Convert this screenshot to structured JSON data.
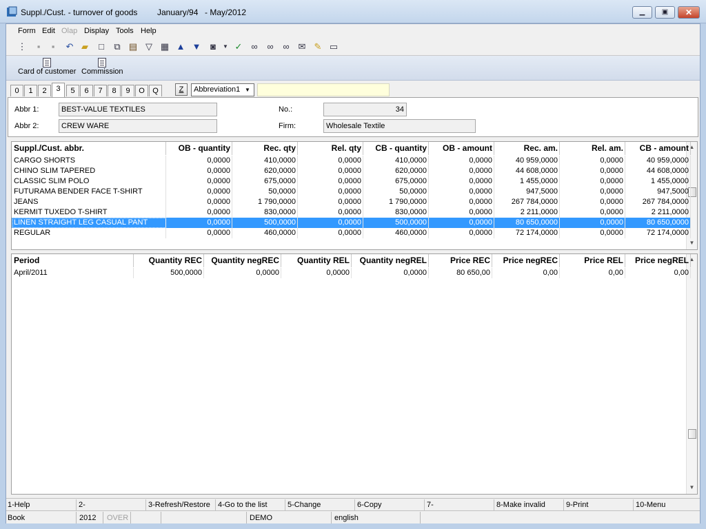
{
  "window": {
    "title": "Suppl./Cust. - turnover of goods",
    "period_from": "January/94",
    "period_to": "- May/2012",
    "min_label": "▁",
    "max_label": "▣",
    "close_label": "✕"
  },
  "menu": [
    "Form",
    "Edit",
    "Olap",
    "Display",
    "Tools",
    "Help"
  ],
  "toolbar_icons": [
    "tree-icon",
    "save-icon",
    "save-all-icon",
    "undo-icon",
    "open-folder-icon",
    "new-document-icon",
    "copy-icon",
    "book-icon",
    "filter-icon",
    "filter-list-icon",
    "arrow-up-icon",
    "arrow-down-icon",
    "camera-icon",
    "dropdown-arrow-icon",
    "check-recycle-icon",
    "binoculars-icon",
    "binoculars-find-icon",
    "binoculars-next-icon",
    "mail-icon",
    "edit-note-icon",
    "report-icon"
  ],
  "commands": {
    "card_of_customer": "Card of customer",
    "commission": "Commission"
  },
  "tabs": [
    "0",
    "1",
    "2",
    "3",
    "5",
    "6",
    "7",
    "8",
    "9",
    "O",
    "Q"
  ],
  "active_tab": "3",
  "z_button": "Z",
  "sort_combo": "Abbreviation1",
  "header": {
    "abbr1_label": "Abbr 1:",
    "abbr1_value": "BEST-VALUE TEXTILES",
    "abbr2_label": "Abbr 2:",
    "abbr2_value": "CREW WARE",
    "no_label": "No.:",
    "no_value": "34",
    "firm_label": "Firm:",
    "firm_value": "Wholesale Textile"
  },
  "top_grid": {
    "columns": [
      "Suppl./Cust. abbr.",
      "OB - quantity",
      "Rec. qty",
      "Rel. qty",
      "CB - quantity",
      "OB - amount",
      "Rec. am.",
      "Rel. am.",
      "CB - amount"
    ],
    "rows": [
      [
        "CARGO SHORTS",
        "0,0000",
        "410,0000",
        "0,0000",
        "410,0000",
        "0,0000",
        "40 959,0000",
        "0,0000",
        "40 959,0000"
      ],
      [
        "CHINO SLIM TAPERED",
        "0,0000",
        "620,0000",
        "0,0000",
        "620,0000",
        "0,0000",
        "44 608,0000",
        "0,0000",
        "44 608,0000"
      ],
      [
        "CLASSIC SLIM POLO",
        "0,0000",
        "675,0000",
        "0,0000",
        "675,0000",
        "0,0000",
        "1 455,0000",
        "0,0000",
        "1 455,0000"
      ],
      [
        "FUTURAMA BENDER FACE T-SHIRT",
        "0,0000",
        "50,0000",
        "0,0000",
        "50,0000",
        "0,0000",
        "947,5000",
        "0,0000",
        "947,5000"
      ],
      [
        "JEANS",
        "0,0000",
        "1 790,0000",
        "0,0000",
        "1 790,0000",
        "0,0000",
        "267 784,0000",
        "0,0000",
        "267 784,0000"
      ],
      [
        "KERMIT TUXEDO T-SHIRT",
        "0,0000",
        "830,0000",
        "0,0000",
        "830,0000",
        "0,0000",
        "2 211,0000",
        "0,0000",
        "2 211,0000"
      ],
      [
        "LINEN STRAIGHT LEG CASUAL PANT",
        "0,0000",
        "500,0000",
        "0,0000",
        "500,0000",
        "0,0000",
        "80 650,0000",
        "0,0000",
        "80 650,0000"
      ],
      [
        "REGULAR",
        "0,0000",
        "460,0000",
        "0,0000",
        "460,0000",
        "0,0000",
        "72 174,0000",
        "0,0000",
        "72 174,0000"
      ]
    ],
    "selected_row": 6
  },
  "bottom_grid": {
    "columns": [
      "Period",
      "Quantity REC",
      "Quantity negREC",
      "Quantity REL",
      "Quantity negREL",
      "Price REC",
      "Price negREC",
      "Price REL",
      "Price negREL"
    ],
    "rows": [
      [
        "April/2011",
        "500,0000",
        "0,0000",
        "0,0000",
        "0,0000",
        "80 650,00",
        "0,00",
        "0,00",
        "0,00"
      ]
    ]
  },
  "fkeys": [
    "1-Help",
    "2-",
    "3-Refresh/Restore",
    "4-Go to the list",
    "5-Change",
    "6-Copy",
    "7-",
    "8-Make invalid",
    "9-Print",
    "10-Menu"
  ],
  "status": {
    "module": "Book",
    "year": "2012",
    "over": "OVER",
    "db": "DEMO",
    "language": "english"
  },
  "colors": {
    "selection": "#3399ff",
    "search_bg": "#ffffdc",
    "title_gradient": "#c3d6ec"
  }
}
